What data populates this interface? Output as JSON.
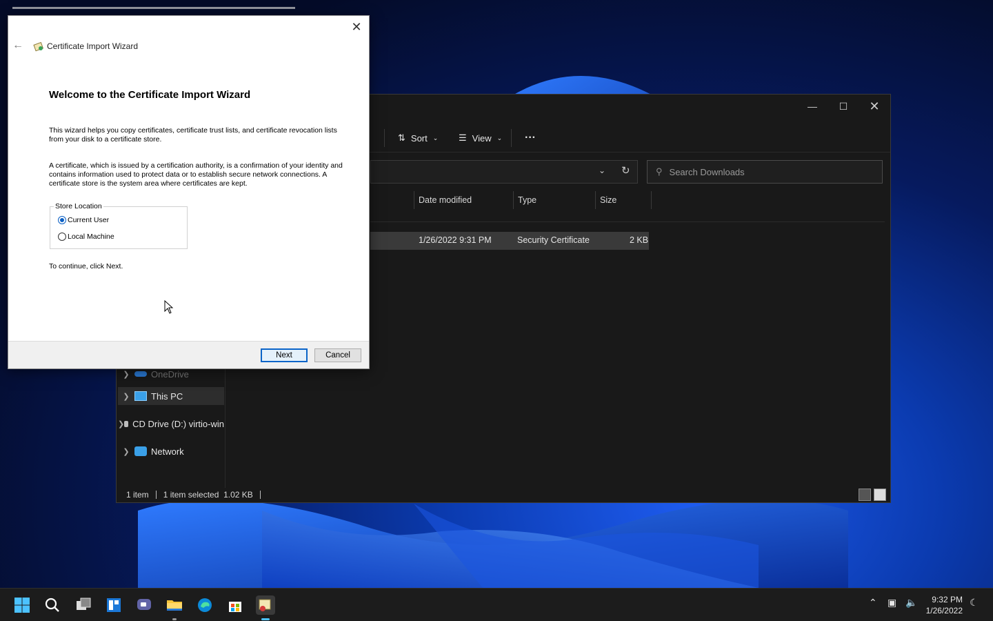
{
  "wizard": {
    "window_title": "Certificate Import Wizard",
    "heading": "Welcome to the Certificate Import Wizard",
    "para1": "This wizard helps you copy certificates, certificate trust lists, and certificate revocation lists from your disk to a certificate store.",
    "para2": "A certificate, which is issued by a certification authority, is a confirmation of your identity and contains information used to protect data or to establish secure network connections. A certificate store is the system area where certificates are kept.",
    "store_location_label": "Store Location",
    "options": [
      {
        "label": "Current User",
        "selected": true
      },
      {
        "label": "Local Machine",
        "selected": false
      }
    ],
    "continue_text": "To continue, click Next.",
    "next_label": "Next",
    "cancel_label": "Cancel"
  },
  "explorer": {
    "toolbar": {
      "sort_label": "Sort",
      "view_label": "View",
      "more_label": "···"
    },
    "search_placeholder": "Search Downloads",
    "columns": [
      "Date modified",
      "Type",
      "Size"
    ],
    "files": [
      {
        "date_modified": "1/26/2022 9:31 PM",
        "type": "Security Certificate",
        "size": "2 KB"
      }
    ],
    "nav": {
      "partial_label": "OneDrive",
      "items": [
        {
          "label": "This PC",
          "icon": "monitor-icon"
        },
        {
          "label": "CD Drive (D:) virtio-win",
          "icon": "cd-drive-icon"
        },
        {
          "label": "Network",
          "icon": "network-icon"
        }
      ]
    },
    "status": {
      "count": "1 item",
      "selected": "1 item selected  1.02 KB"
    }
  },
  "taskbar": {
    "icons": [
      "start-icon",
      "search-icon",
      "task-view-icon",
      "widgets-icon",
      "chat-icon",
      "file-explorer-icon",
      "edge-icon",
      "store-icon",
      "certificate-wizard-icon"
    ],
    "time": "9:32 PM",
    "date": "1/26/2022"
  },
  "colors": {
    "accent": "#0a64c8",
    "taskbar_active": "#4cc2ff",
    "explorer_bg": "#191919"
  }
}
